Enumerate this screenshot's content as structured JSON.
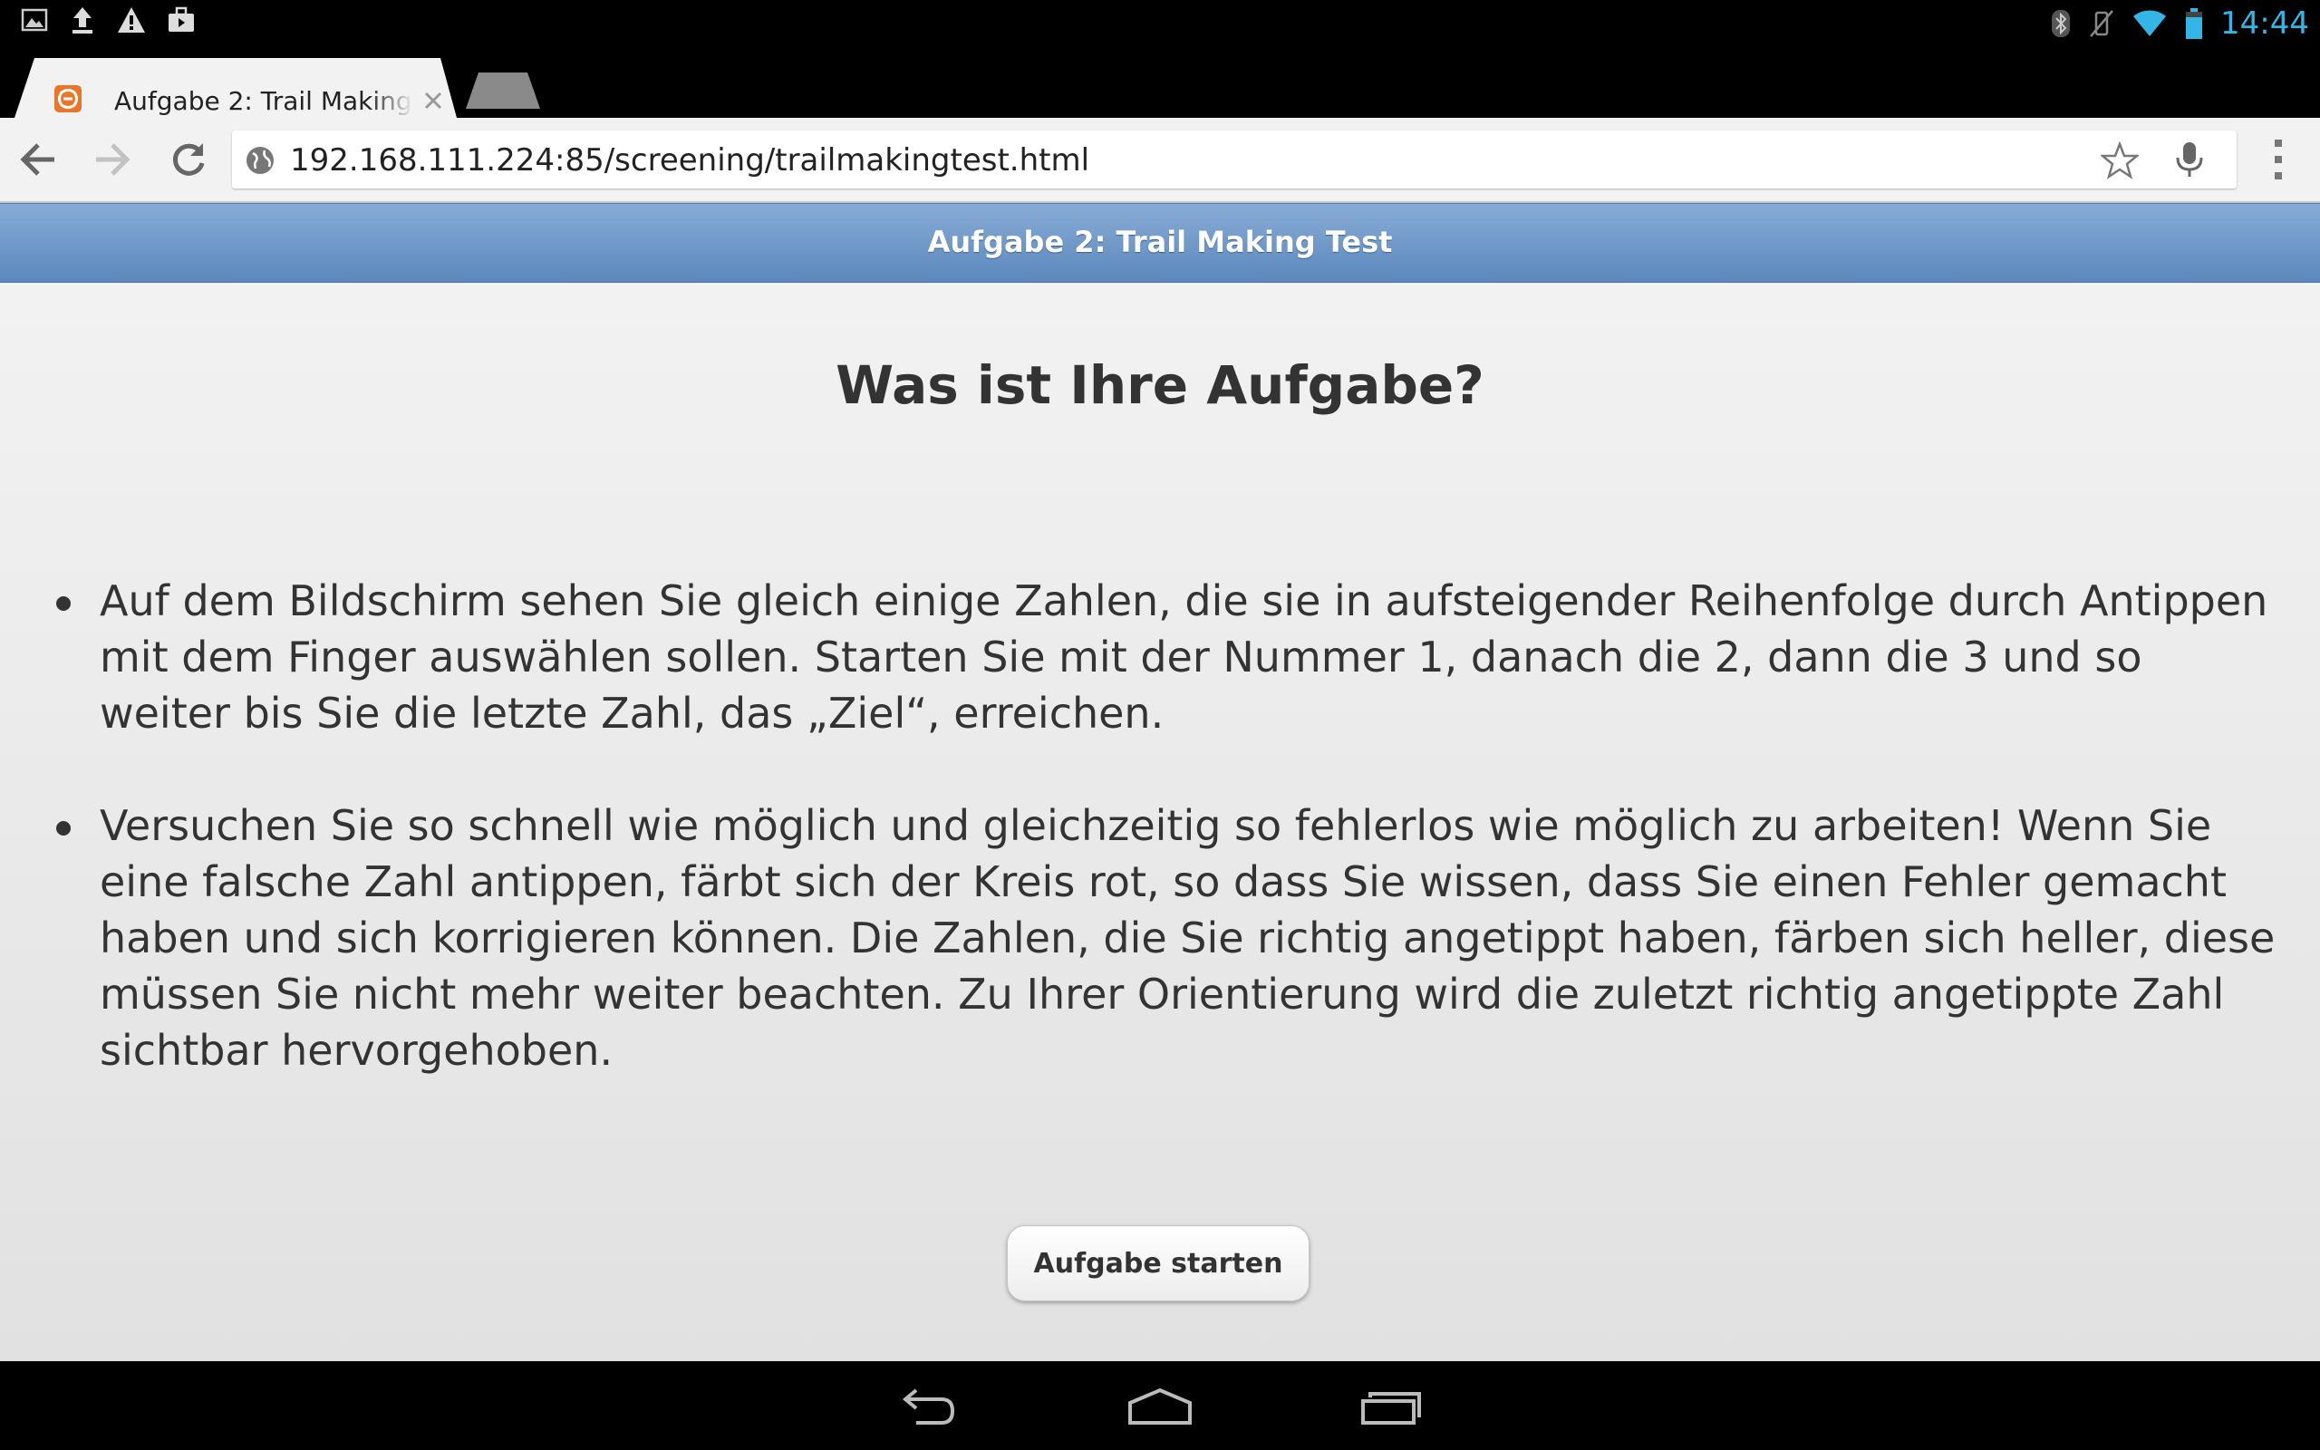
{
  "status_bar": {
    "clock": "14:44",
    "left_icons": [
      "picture-icon",
      "upload-icon",
      "warning-icon",
      "briefcase-icon"
    ],
    "right_icons": [
      "bluetooth-icon",
      "vibrate-icon",
      "wifi-icon",
      "battery-icon"
    ],
    "clock_color": "#33b5e5"
  },
  "browser": {
    "tab": {
      "title": "Aufgabe 2: Trail Making Test",
      "favicon": "app-icon",
      "favicon_color": "#e8762b"
    },
    "url": "192.168.111.224:85/screening/trailmakingtest.html"
  },
  "page": {
    "header_title": "Aufgabe 2: Trail Making Test",
    "header_color": "#6f97c9",
    "heading": "Was ist Ihre Aufgabe?",
    "bullets": [
      "Auf dem Bildschirm sehen Sie gleich einige Zahlen, die sie in aufsteigender Reihenfolge durch Antippen mit dem Finger auswählen sollen. Starten Sie mit der Nummer 1, danach die 2, dann die 3 und so weiter bis Sie die letzte Zahl, das „Ziel“, erreichen.",
      "Versuchen Sie so schnell wie möglich und gleichzeitig so fehlerlos wie möglich zu arbeiten! Wenn Sie eine falsche Zahl antippen, färbt sich der Kreis rot, so dass Sie wissen, dass Sie einen Fehler gemacht haben und sich korrigieren können. Die Zahlen, die Sie richtig angetippt haben, färben sich heller, diese müssen Sie nicht mehr weiter beachten. Zu Ihrer Orientierung wird die zuletzt richtig angetippte Zahl sichtbar hervorgehoben."
    ],
    "start_button": "Aufgabe starten"
  },
  "nav_bar": {
    "icons": [
      "back-icon",
      "home-icon",
      "recent-apps-icon"
    ]
  }
}
